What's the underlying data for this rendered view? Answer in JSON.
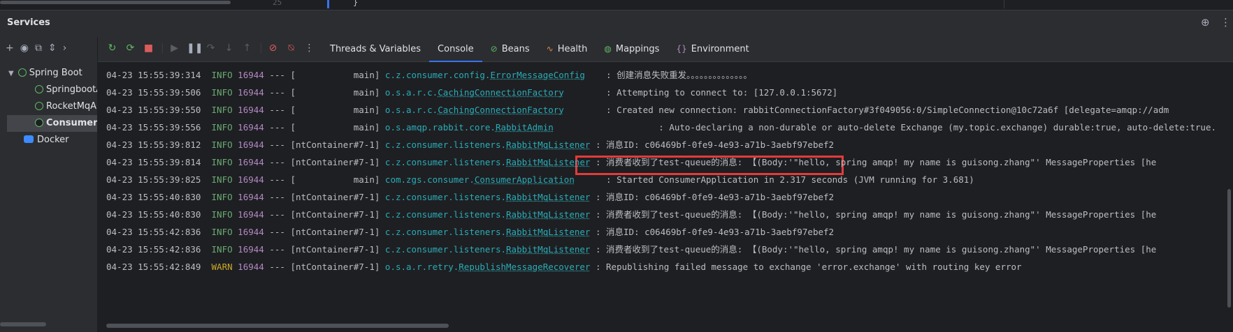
{
  "editor_strip": {
    "line_number": "25",
    "brace": "}"
  },
  "header": {
    "title": "Services"
  },
  "left": {
    "tools": [
      "add-icon",
      "eye-icon",
      "new-tab-icon",
      "expand-icon",
      "more-icon"
    ],
    "tree": [
      {
        "label": "Spring Boot",
        "level": 0,
        "expanded": true
      },
      {
        "label": "SpringbootApplication",
        "level": 1
      },
      {
        "label": "RocketMqApplication",
        "level": 1
      },
      {
        "label": "ConsumerApplication",
        "level": 1,
        "selected": true
      },
      {
        "label": "Docker",
        "level": 0
      }
    ]
  },
  "tabs": [
    {
      "label": "Threads & Variables",
      "icon": ""
    },
    {
      "label": "Console",
      "icon": "",
      "active": true
    },
    {
      "label": "Beans",
      "icon": "beans-icon"
    },
    {
      "label": "Health",
      "icon": "health-icon"
    },
    {
      "label": "Mappings",
      "icon": "mappings-icon"
    },
    {
      "label": "Environment",
      "icon": "environment-icon"
    }
  ],
  "console": {
    "lines": [
      {
        "ts": "04-23 15:55:39:314",
        "level": "INFO",
        "pid": "16944",
        "sep": "---",
        "thread": "[           main]",
        "pkg": "c.z.consumer.config.",
        "cls": "ErrorMessageConfig",
        "pad": "    ",
        "msg": ": 创建消息失败重发。。。。。。。。。。。。。。"
      },
      {
        "ts": "04-23 15:55:39:506",
        "level": "INFO",
        "pid": "16944",
        "sep": "---",
        "thread": "[           main]",
        "pkg": "o.s.a.r.c.",
        "cls": "CachingConnectionFactory",
        "pad": "        ",
        "msg": ": Attempting to connect to: [127.0.0.1:5672]"
      },
      {
        "ts": "04-23 15:55:39:550",
        "level": "INFO",
        "pid": "16944",
        "sep": "---",
        "thread": "[           main]",
        "pkg": "o.s.a.r.c.",
        "cls": "CachingConnectionFactory",
        "pad": "        ",
        "msg": ": Created new connection: rabbitConnectionFactory#3f049056:0/SimpleConnection@10c72a6f [delegate=amqp://adm"
      },
      {
        "ts": "04-23 15:55:39:556",
        "level": "INFO",
        "pid": "16944",
        "sep": "---",
        "thread": "[           main]",
        "pkg": "o.s.amqp.rabbit.core.",
        "cls": "RabbitAdmin",
        "pad": "                    ",
        "msg": ": Auto-declaring a non-durable or auto-delete Exchange (my.topic.exchange) durable:true, auto-delete:true."
      },
      {
        "ts": "04-23 15:55:39:812",
        "level": "INFO",
        "pid": "16944",
        "sep": "---",
        "thread": "[ntContainer#7-1]",
        "pkg": "c.z.consumer.listeners.",
        "cls": "RabbitMqListener",
        "pad": " ",
        "msg": ": 消息ID: c06469bf-0fe9-4e93-a71b-3aebf97ebef2"
      },
      {
        "ts": "04-23 15:55:39:814",
        "level": "INFO",
        "pid": "16944",
        "sep": "---",
        "thread": "[ntContainer#7-1]",
        "pkg": "c.z.consumer.listeners.",
        "cls": "RabbitMqListener",
        "pad": " ",
        "msg": ": 消费者收到了test-queue的消息: 【(Body:'\"hello, spring amqp! my name is guisong.zhang\"' MessageProperties [he"
      },
      {
        "ts": "04-23 15:55:39:825",
        "level": "INFO",
        "pid": "16944",
        "sep": "---",
        "thread": "[           main]",
        "pkg": "com.zgs.consumer.",
        "cls": "ConsumerApplication",
        "pad": "      ",
        "msg": ": Started ConsumerApplication in 2.317 seconds (JVM running for 3.681)"
      },
      {
        "ts": "04-23 15:55:40:830",
        "level": "INFO",
        "pid": "16944",
        "sep": "---",
        "thread": "[ntContainer#7-1]",
        "pkg": "c.z.consumer.listeners.",
        "cls": "RabbitMqListener",
        "pad": " ",
        "msg": ": 消息ID: c06469bf-0fe9-4e93-a71b-3aebf97ebef2"
      },
      {
        "ts": "04-23 15:55:40:830",
        "level": "INFO",
        "pid": "16944",
        "sep": "---",
        "thread": "[ntContainer#7-1]",
        "pkg": "c.z.consumer.listeners.",
        "cls": "RabbitMqListener",
        "pad": " ",
        "msg": ": 消费者收到了test-queue的消息: 【(Body:'\"hello, spring amqp! my name is guisong.zhang\"' MessageProperties [he"
      },
      {
        "ts": "04-23 15:55:42:836",
        "level": "INFO",
        "pid": "16944",
        "sep": "---",
        "thread": "[ntContainer#7-1]",
        "pkg": "c.z.consumer.listeners.",
        "cls": "RabbitMqListener",
        "pad": " ",
        "msg": ": 消息ID: c06469bf-0fe9-4e93-a71b-3aebf97ebef2"
      },
      {
        "ts": "04-23 15:55:42:836",
        "level": "INFO",
        "pid": "16944",
        "sep": "---",
        "thread": "[ntContainer#7-1]",
        "pkg": "c.z.consumer.listeners.",
        "cls": "RabbitMqListener",
        "pad": " ",
        "msg": ": 消费者收到了test-queue的消息: 【(Body:'\"hello, spring amqp! my name is guisong.zhang\"' MessageProperties [he"
      },
      {
        "ts": "04-23 15:55:42:849",
        "level": "WARN",
        "pid": "16944",
        "sep": "---",
        "thread": "[ntContainer#7-1]",
        "pkg": "o.s.a.r.retry.",
        "cls": "RepublishMessageRecoverer",
        "pad": " ",
        "msg": ": Republishing failed message to exchange 'error.exchange' with routing key error"
      }
    ]
  },
  "colors": {
    "accent": "#3574f0",
    "highlight": "#e23b3b",
    "info": "#6aab73",
    "warn": "#c9a82b",
    "logger": "#2aacb8",
    "pid": "#b389c5"
  }
}
